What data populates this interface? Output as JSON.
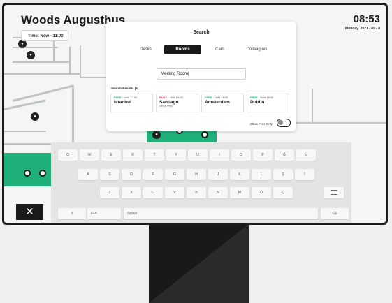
{
  "header": {
    "title": "Woods Augusthus",
    "time_filter": "Time: Now - 11:00",
    "clock": "08:53",
    "day": "Monday",
    "date": "2021 - 09 - 8"
  },
  "search": {
    "title": "Search",
    "tabs": [
      "Desks",
      "Rooms",
      "Cars",
      "Colleagues"
    ],
    "active_tab": "Rooms",
    "query": "Meeting Room",
    "results_label": "Search Results (5)",
    "results": [
      {
        "status": "FREE",
        "until": "· Until 12:00",
        "name": "Istanbul",
        "sub": ""
      },
      {
        "status": "BUSY",
        "until": "· Until 14:00",
        "name": "Santiago",
        "sub": "Henrik Petrin"
      },
      {
        "status": "FREE",
        "until": "· Until 16:00",
        "name": "Amsterdam",
        "sub": ""
      },
      {
        "status": "FREE",
        "until": "· Until 16:00",
        "name": "Dublin",
        "sub": ""
      }
    ],
    "show_free_only": "Show Free Only"
  },
  "keyboard": {
    "row1": [
      "Q",
      "W",
      "E",
      "R",
      "T",
      "Y",
      "U",
      "I",
      "O",
      "P",
      "Ğ",
      "Ü"
    ],
    "row2": [
      "A",
      "S",
      "D",
      "F",
      "G",
      "H",
      "J",
      "K",
      "L",
      "Ş",
      "İ"
    ],
    "row3": [
      "Z",
      "X",
      "C",
      "V",
      "B",
      "N",
      "M",
      "Ö",
      "Ç"
    ],
    "symbols": "#+=",
    "space": "Space"
  },
  "colors": {
    "accent": "#1fb07a",
    "busy": "#e23a5c",
    "dark": "#1a1a1a"
  }
}
